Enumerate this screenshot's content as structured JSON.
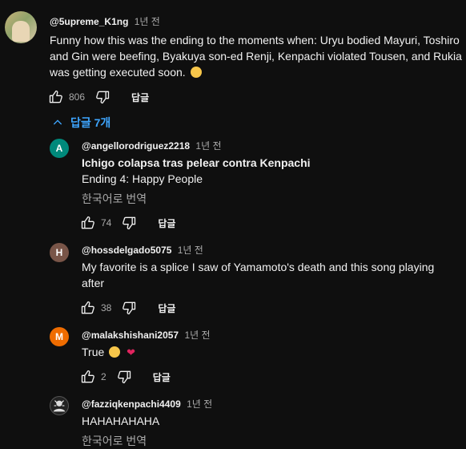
{
  "top_comment": {
    "author": "@5upreme_K1ng",
    "time": "1년 전",
    "text": "Funny how this was the ending to the moments when: Uryu bodied Mayuri, Toshiro and Gin were beefing, Byakuya son-ed Renji, Kenpachi violated Tousen, and Rukia was getting executed soon.",
    "likes": "806",
    "reply_label": "답글"
  },
  "replies_toggle": {
    "label": "답글 7개"
  },
  "replies": [
    {
      "avatar_letter": "A",
      "avatar_color": "#00897b",
      "author": "@angellorodriguez2218",
      "time": "1년 전",
      "text_line1": "Ichigo colapsa tras pelear contra Kenpachi",
      "text_line2": "Ending 4: Happy People",
      "translate": "한국어로 번역",
      "likes": "74",
      "reply_label": "답글"
    },
    {
      "avatar_letter": "H",
      "avatar_color": "#795548",
      "author": "@hossdelgado5075",
      "time": "1년 전",
      "text": "My favorite is a splice I saw of Yamamoto's death and this song playing after",
      "likes": "38",
      "reply_label": "답글"
    },
    {
      "avatar_letter": "M",
      "avatar_color": "#ef6c00",
      "author": "@malakshishani2057",
      "time": "1년 전",
      "text": "True",
      "likes": "2",
      "reply_label": "답글"
    },
    {
      "author": "@fazziqkenpachi4409",
      "time": "1년 전",
      "text": "HAHAHAHAHA",
      "translate": "한국어로 번역"
    }
  ]
}
